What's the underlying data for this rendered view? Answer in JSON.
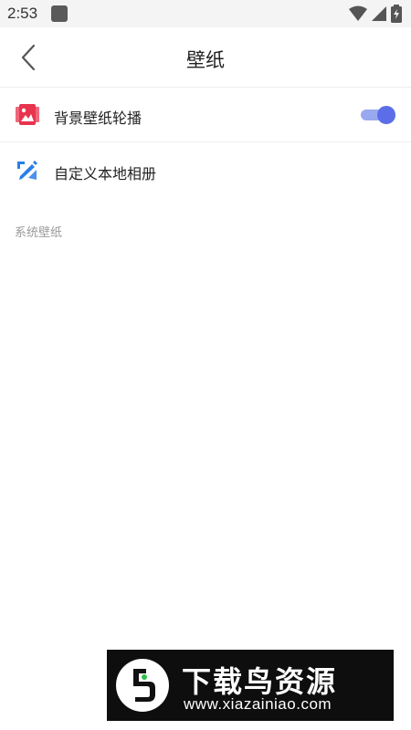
{
  "status_bar": {
    "time": "2:53",
    "icons": [
      "app-notification-icon",
      "wifi-icon",
      "signal-icon",
      "battery-charging-icon"
    ]
  },
  "title_bar": {
    "back_icon": "chevron-left-icon",
    "title": "壁纸"
  },
  "settings": [
    {
      "label": "背景壁纸轮播",
      "icon": "image-carousel-icon",
      "icon_color": "#e8344e",
      "toggle_on": true
    },
    {
      "label": "自定义本地相册",
      "icon": "pencil-edit-icon",
      "icon_color": "#2a7fe8"
    }
  ],
  "section_header": "系统壁纸",
  "colors": {
    "toggle_track": "#9aa8f0",
    "toggle_knob": "#5b6ee8",
    "section_text": "#999999"
  },
  "watermark": {
    "title": "下载鸟资源",
    "url": "www.xiazainiao.com"
  }
}
